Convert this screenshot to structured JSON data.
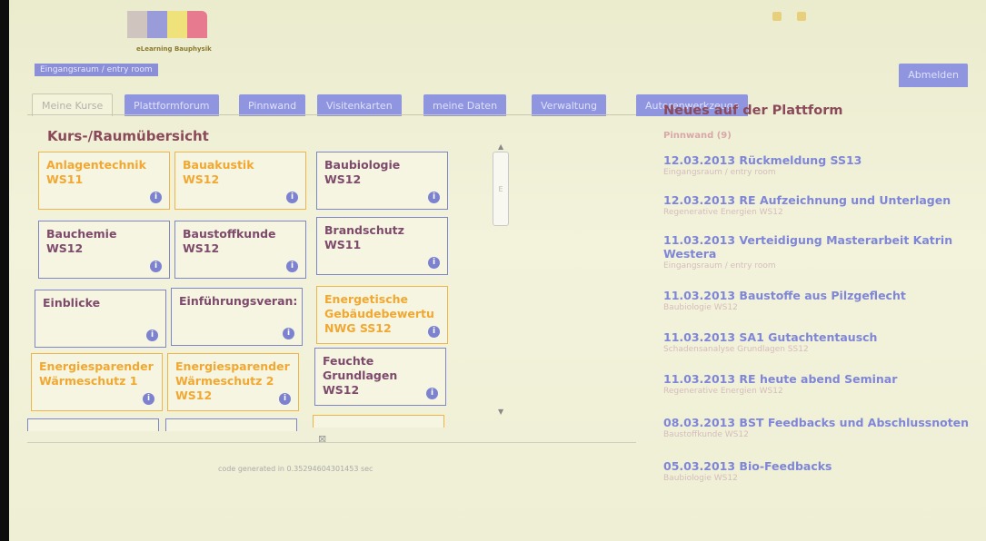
{
  "logo": {
    "caption": "eLearning Bauphysik",
    "colors": [
      "#d0c4bf",
      "#9a9cda",
      "#f0e27b",
      "#e87a90"
    ]
  },
  "breadcrumb": "Eingangsraum / entry room",
  "tabs": [
    {
      "label": "Meine Kurse"
    },
    {
      "label": "Plattformforum"
    },
    {
      "label": "Pinnwand"
    },
    {
      "label": "Visitenkarten"
    },
    {
      "label": "meine Daten"
    },
    {
      "label": "Verwaltung"
    },
    {
      "label": "Autorenwerkzeuge"
    }
  ],
  "logout": "Abmelden",
  "overview_title": "Kurs-/Raumübersicht",
  "courses": [
    {
      "lines": [
        "Anlagentechnik",
        "WS11"
      ],
      "style": "orange"
    },
    {
      "lines": [
        "Bauakustik",
        "WS12"
      ],
      "style": "orange"
    },
    {
      "lines": [
        "Baubiologie",
        "WS12"
      ],
      "style": "blue"
    },
    {
      "lines": [
        "Bauchemie",
        "WS12"
      ],
      "style": "blue"
    },
    {
      "lines": [
        "Baustoffkunde",
        "WS12"
      ],
      "style": "blue"
    },
    {
      "lines": [
        "Brandschutz",
        "WS11"
      ],
      "style": "blue"
    },
    {
      "lines": [
        "Einblicke"
      ],
      "style": "blue"
    },
    {
      "lines": [
        "Einführungsveran:"
      ],
      "style": "blue"
    },
    {
      "lines": [
        "Energetische",
        "Gebäudebewertu",
        "NWG SS12"
      ],
      "style": "orange"
    },
    {
      "lines": [
        "Energiesparender",
        "Wärmeschutz 1"
      ],
      "style": "orange"
    },
    {
      "lines": [
        "Energiesparender",
        "Wärmeschutz 2",
        "WS12"
      ],
      "style": "orange"
    },
    {
      "lines": [
        "Feuchte",
        "Grundlagen",
        "WS12"
      ],
      "style": "blue"
    }
  ],
  "scroll_letter": "E",
  "generated": "code generated in 0.35294604301453 sec",
  "news": {
    "title": "Neues auf der Plattform",
    "subtitle": "Pinnwand (9)",
    "items": [
      {
        "head": "12.03.2013 Rückmeldung SS13",
        "room": "Eingangsraum / entry room"
      },
      {
        "head": "12.03.2013 RE Aufzeichnung und Unterlagen",
        "room": "Regenerative Energien WS12"
      },
      {
        "head": "11.03.2013 Verteidigung Masterarbeit Katrin Westera",
        "room": "Eingangsraum / entry room"
      },
      {
        "head": "11.03.2013 Baustoffe aus Pilzgeflecht",
        "room": "Baubiologie WS12"
      },
      {
        "head": "11.03.2013 SA1 Gutachtentausch",
        "room": "Schadensanalyse Grundlagen SS12"
      },
      {
        "head": "11.03.2013 RE heute abend Seminar",
        "room": "Regenerative Energien WS12"
      },
      {
        "head": "08.03.2013 BST Feedbacks und Abschlussnoten",
        "room": "Baustoffkunde WS12"
      },
      {
        "head": "05.03.2013 Bio-Feedbacks",
        "room": "Baubiologie WS12"
      }
    ]
  }
}
